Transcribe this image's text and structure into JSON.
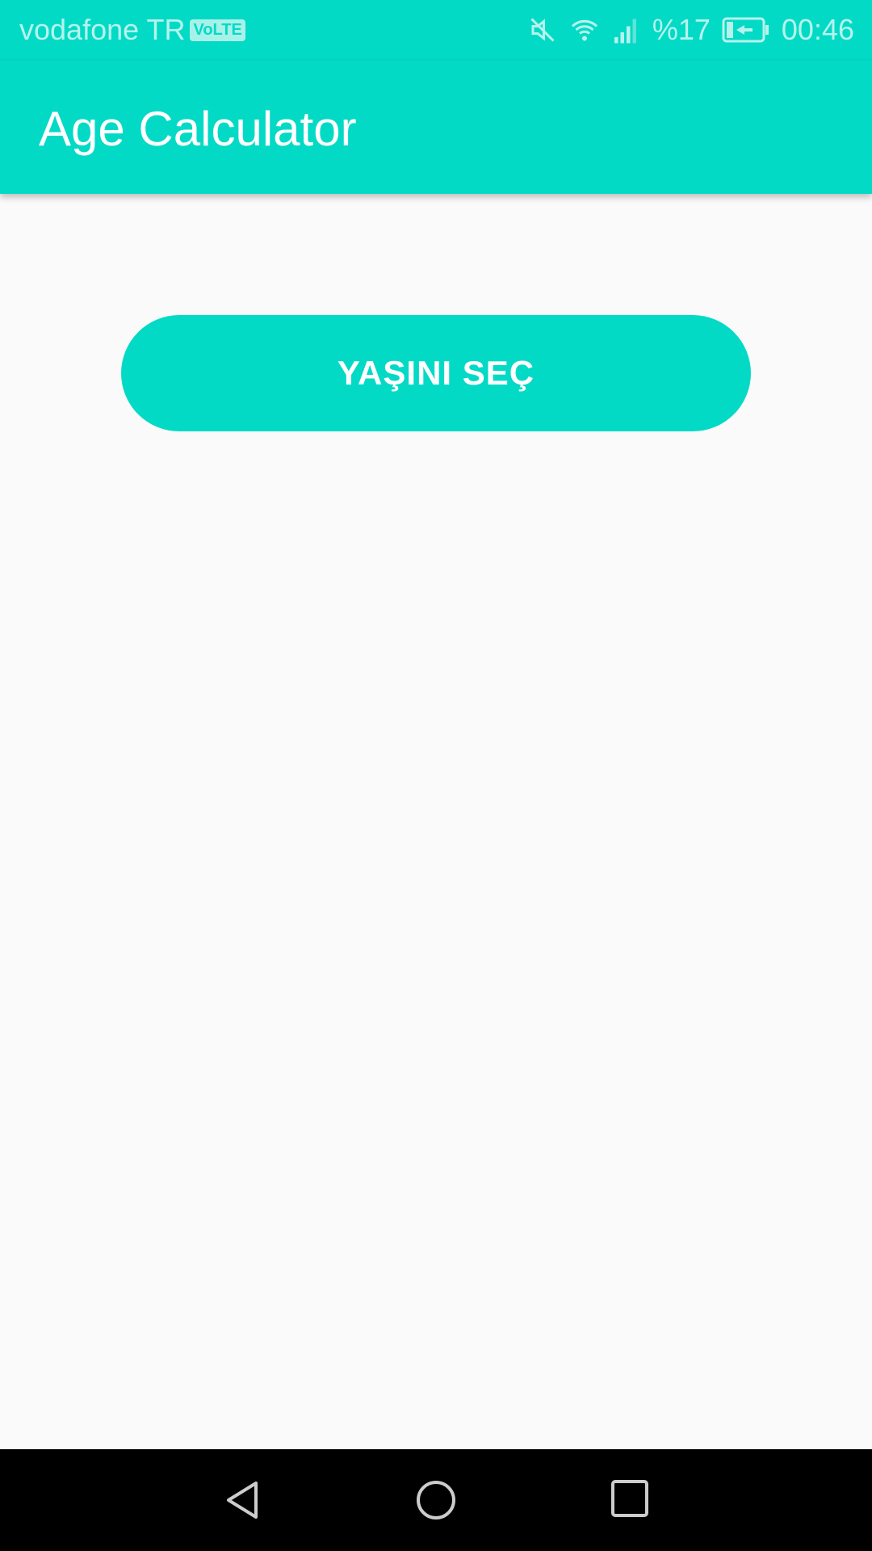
{
  "status_bar": {
    "carrier": "vodafone TR",
    "volte": "VoLTE",
    "battery": "%17",
    "time": "00:46",
    "icons": [
      "mute-icon",
      "wifi-icon",
      "signal-icon",
      "battery-charging-icon"
    ]
  },
  "app_bar": {
    "title": "Age Calculator"
  },
  "main": {
    "pick_age_button": "YAŞINI SEÇ"
  },
  "colors": {
    "accent": "#03dac6",
    "background": "#fafafa"
  },
  "nav_bar": {
    "icons": [
      "back-icon",
      "home-icon",
      "recents-icon"
    ]
  }
}
